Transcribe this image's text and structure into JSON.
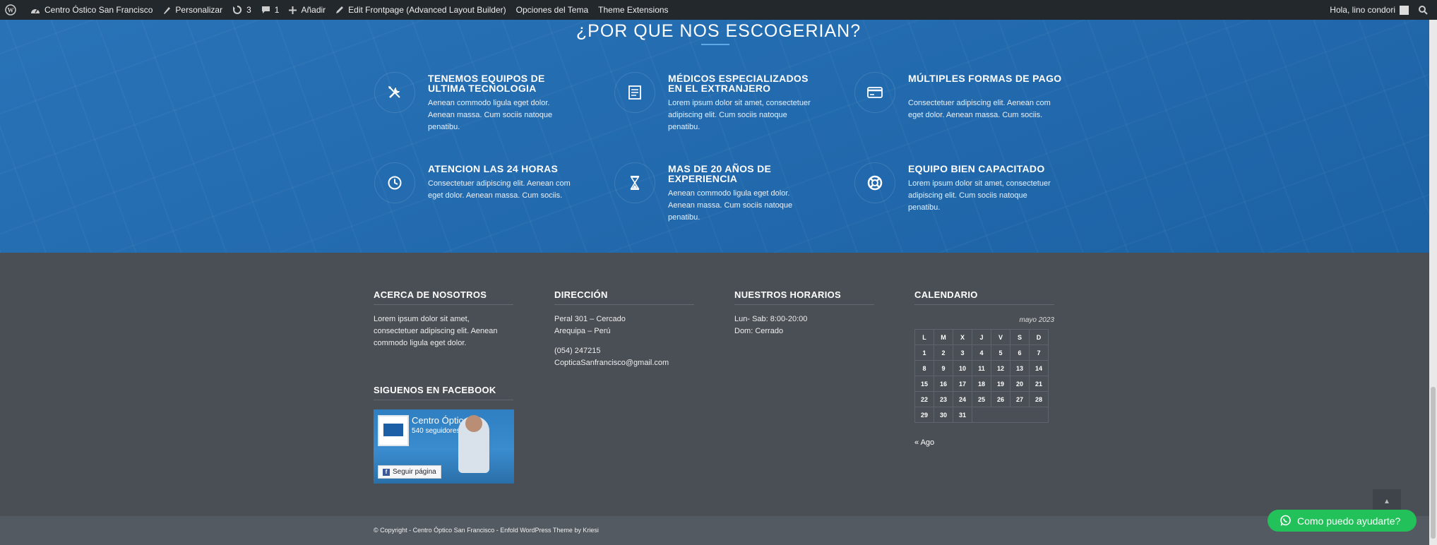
{
  "adminbar": {
    "site_name": "Centro Óstico San Francisco",
    "customize": "Personalizar",
    "updates_count": "3",
    "comments_count": "1",
    "add_new": "Añadir",
    "edit_frontpage": "Edit Frontpage (Advanced Layout Builder)",
    "theme_options": "Opciones del Tema",
    "theme_extensions": "Theme Extensions",
    "greeting": "Hola, lino condori"
  },
  "hero": {
    "title": "¿POR QUE NOS ESCOGERIAN?",
    "features": [
      {
        "title": "TENEMOS EQUIPOS DE ULTIMA TECNOLOGIA",
        "text": "Aenean commodo ligula eget dolor. Aenean massa. Cum sociis natoque penatibu.",
        "icon": "tools-icon"
      },
      {
        "title": "MÉDICOS ESPECIALIZADOS EN EL EXTRANJERO",
        "text": "Lorem ipsum dolor sit amet, consectetuer adipiscing elit.  Cum sociis natoque penatibu.",
        "icon": "document-icon"
      },
      {
        "title": "MÚLTIPLES FORMAS DE PAGO",
        "text": "Consectetuer adipiscing elit. Aenean com eget dolor. Aenean massa. Cum sociis.",
        "icon": "credit-card-icon"
      },
      {
        "title": "ATENCION LAS 24 HORAS",
        "text": "Consectetuer adipiscing elit. Aenean com eget dolor. Aenean massa. Cum sociis.",
        "icon": "clock-icon"
      },
      {
        "title": "MAS DE 20 AÑOS DE EXPERIENCIA",
        "text": "Aenean commodo ligula eget dolor. Aenean massa. Cum sociis natoque penatibu.",
        "icon": "hourglass-icon"
      },
      {
        "title": "EQUIPO BIEN CAPACITADO",
        "text": "Lorem ipsum dolor sit amet, consectetuer adipiscing elit.  Cum sociis natoque penatibu.",
        "icon": "lifebuoy-icon"
      }
    ]
  },
  "footer": {
    "about": {
      "heading": "ACERCA DE NOSOTROS",
      "text": "Lorem ipsum dolor sit amet, consectetuer adipiscing elit. Aenean commodo ligula eget dolor."
    },
    "facebook": {
      "heading": "SIGUENOS EN FACEBOOK",
      "page_name": "Centro Óptico S...",
      "followers": "540 seguidores",
      "follow_label": "Seguir página"
    },
    "address": {
      "heading": "DIRECCIÓN",
      "line1": "Peral 301 – Cercado",
      "line2": "Arequipa – Perú",
      "phone": "(054) 247215",
      "email": "CopticaSanfrancisco@gmail.com"
    },
    "hours": {
      "heading": "NUESTROS HORARIOS",
      "line1": "Lun- Sab: 8:00-20:00",
      "line2": "Dom: Cerrado"
    },
    "calendar": {
      "heading": "CALENDARIO",
      "caption": "mayo 2023",
      "weekdays": [
        "L",
        "M",
        "X",
        "J",
        "V",
        "S",
        "D"
      ],
      "weeks": [
        [
          "1",
          "2",
          "3",
          "4",
          "5",
          "6",
          "7"
        ],
        [
          "8",
          "9",
          "10",
          "11",
          "12",
          "13",
          "14"
        ],
        [
          "15",
          "16",
          "17",
          "18",
          "19",
          "20",
          "21"
        ],
        [
          "22",
          "23",
          "24",
          "25",
          "26",
          "27",
          "28"
        ],
        [
          "29",
          "30",
          "31",
          "",
          "",
          "",
          ""
        ]
      ],
      "prev_link": "« Ago"
    },
    "copyright": "© Copyright - Centro Óptico San Francisco - Enfold WordPress Theme by Kriesi"
  },
  "whatsapp_label": "Como puedo ayudarte?",
  "colors": {
    "hero_blue": "#1e6bb3",
    "footer_gray": "#4a4f55",
    "whatsapp_green": "#23c15a",
    "adminbar": "#23282d"
  }
}
